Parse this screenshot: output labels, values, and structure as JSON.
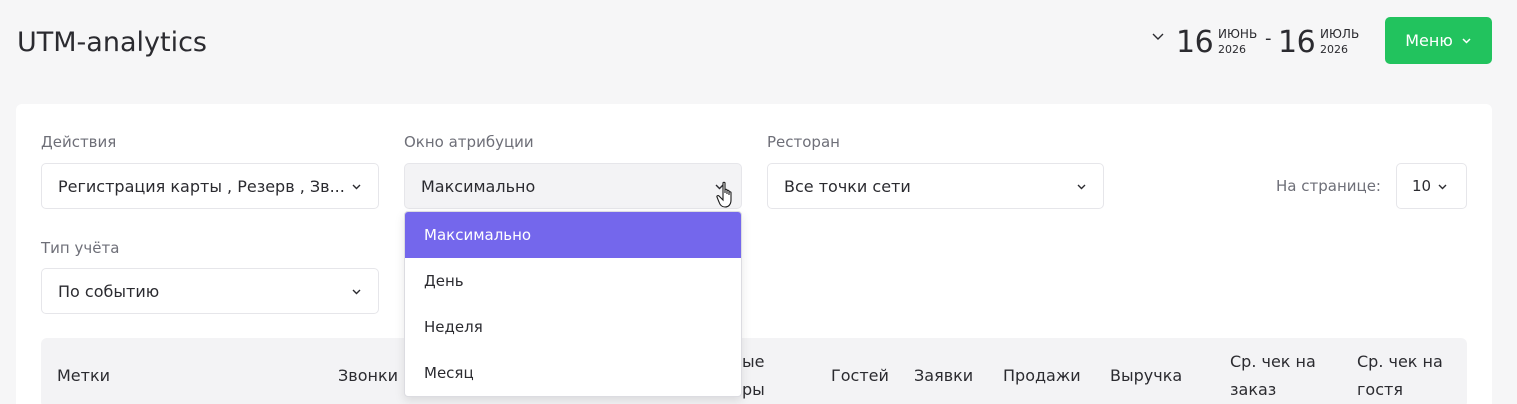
{
  "header": {
    "title": "UTM-analytics",
    "date_from": {
      "day": "16",
      "month": "ИЮНЬ",
      "year": "2026"
    },
    "date_to": {
      "day": "16",
      "month": "ИЮЛЬ",
      "year": "2026"
    },
    "separator": "-",
    "menu_label": "Меню",
    "menu_color": "#22c35e"
  },
  "filters": {
    "actions": {
      "label": "Действия",
      "value": "Регистрация карты , Резерв , Зв..."
    },
    "attribution": {
      "label": "Окно атрибуции",
      "value": "Максимально"
    },
    "restaurant": {
      "label": "Ресторан",
      "value": "Все точки сети"
    },
    "per_page": {
      "label": "На странице:",
      "value": "10"
    },
    "account_type": {
      "label": "Тип учёта",
      "value": "По событию"
    }
  },
  "dropdown": {
    "options": [
      "Максимально",
      "День",
      "Неделя",
      "Месяц"
    ],
    "selected_index": 0,
    "highlight_color": "#7467ec"
  },
  "table": {
    "headers": {
      "tags": "Метки",
      "calls": "Звонки",
      "partial_top": "ые",
      "partial_bottom": "ры",
      "partial_left": "р",
      "guests": "Гостей",
      "requests": "Заявки",
      "sales": "Продажи",
      "revenue": "Выручка",
      "avg_order_1": "Ср. чек на",
      "avg_order_2": "заказ",
      "avg_guest_1": "Ср. чек на",
      "avg_guest_2": "гостя"
    }
  }
}
